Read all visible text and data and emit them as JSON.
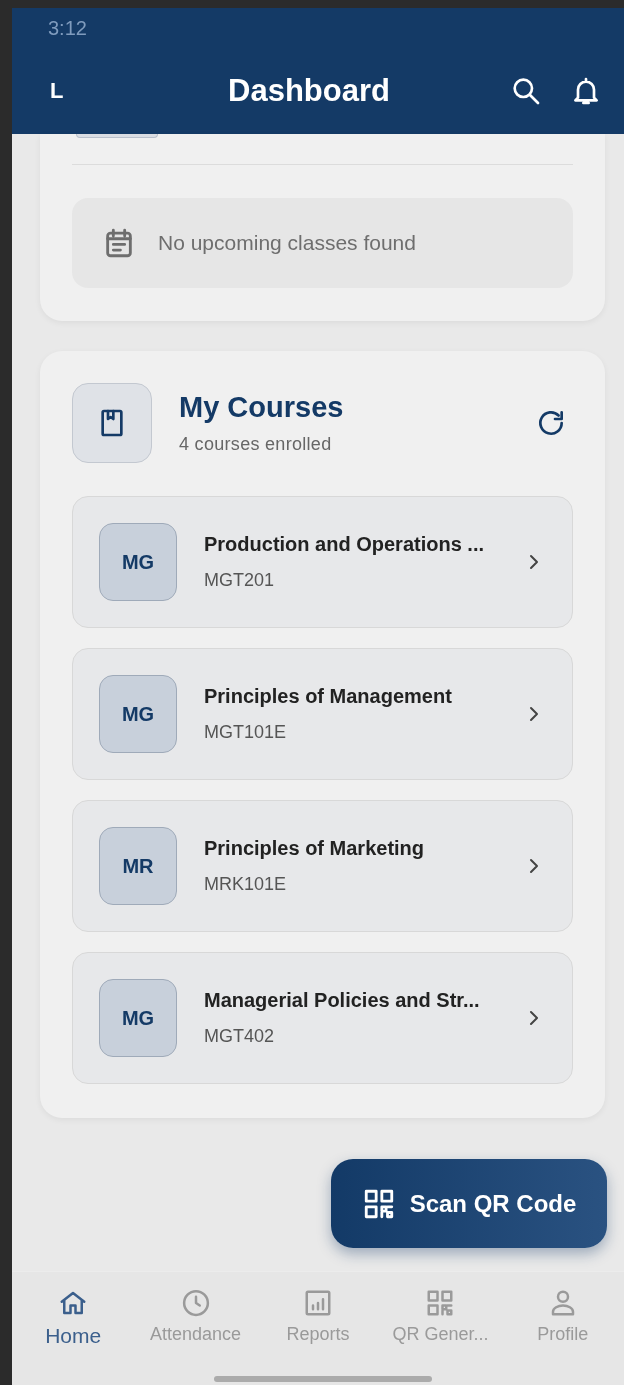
{
  "status_bar": {
    "time": "3:12"
  },
  "header": {
    "avatar_letter": "L",
    "title": "Dashboard"
  },
  "upcoming": {
    "empty_message": "No upcoming classes found"
  },
  "courses": {
    "title": "My Courses",
    "subtitle": "4 courses enrolled",
    "items": [
      {
        "initials": "MG",
        "name": "Production and Operations ...",
        "code": "MGT201"
      },
      {
        "initials": "MG",
        "name": "Principles of Management",
        "code": "MGT101E"
      },
      {
        "initials": "MR",
        "name": "Principles of Marketing",
        "code": "MRK101E"
      },
      {
        "initials": "MG",
        "name": "Managerial Policies and Str...",
        "code": "MGT402"
      }
    ]
  },
  "fab": {
    "label": "Scan QR Code"
  },
  "bottom_nav": [
    {
      "kind": "home",
      "label": "Home",
      "selected": true
    },
    {
      "kind": "clock",
      "label": "Attendance",
      "selected": false
    },
    {
      "kind": "chart",
      "label": "Reports",
      "selected": false
    },
    {
      "kind": "qr",
      "label": "QR Gener...",
      "selected": false
    },
    {
      "kind": "person",
      "label": "Profile",
      "selected": false
    }
  ]
}
